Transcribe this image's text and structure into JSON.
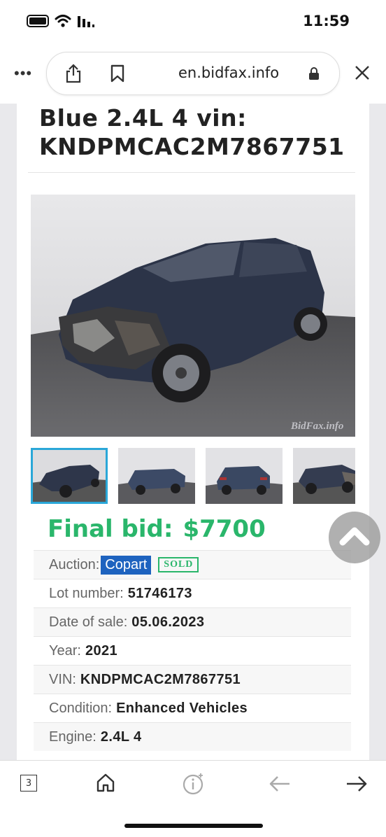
{
  "status_bar": {
    "time": "11:59"
  },
  "browser": {
    "url": "en.bidfax.info"
  },
  "listing": {
    "title_line1": "Blue 2.4L 4 vin:",
    "title_line2": "KNDPMCAC2M7867751",
    "watermark": "BidFax.info",
    "final_bid_label": "Final bid:",
    "final_bid_value": "$7700",
    "details": [
      {
        "label": "Auction:",
        "value": "Copart",
        "badge": "SOLD"
      },
      {
        "label": "Lot number:",
        "value": "51746173"
      },
      {
        "label": "Date of sale:",
        "value": "05.06.2023"
      },
      {
        "label": "Year:",
        "value": "2021"
      },
      {
        "label": "VIN:",
        "value": "KNDPMCAC2M7867751"
      },
      {
        "label": "Condition:",
        "value": "Enhanced Vehicles"
      },
      {
        "label": "Engine:",
        "value": "2.4L 4"
      }
    ]
  },
  "toolbar": {
    "tab_count": "3"
  },
  "colors": {
    "accent_green": "#2ab66b",
    "auction_blue": "#1e63bf",
    "thumb_selected": "#2aa7d8"
  },
  "icons": [
    "battery-icon",
    "wifi-icon",
    "signal-icon",
    "share-icon",
    "bookmark-icon",
    "lock-icon",
    "close-icon",
    "chevron-up-icon",
    "home-icon",
    "info-sparkle-icon",
    "back-arrow-icon",
    "forward-arrow-icon"
  ]
}
